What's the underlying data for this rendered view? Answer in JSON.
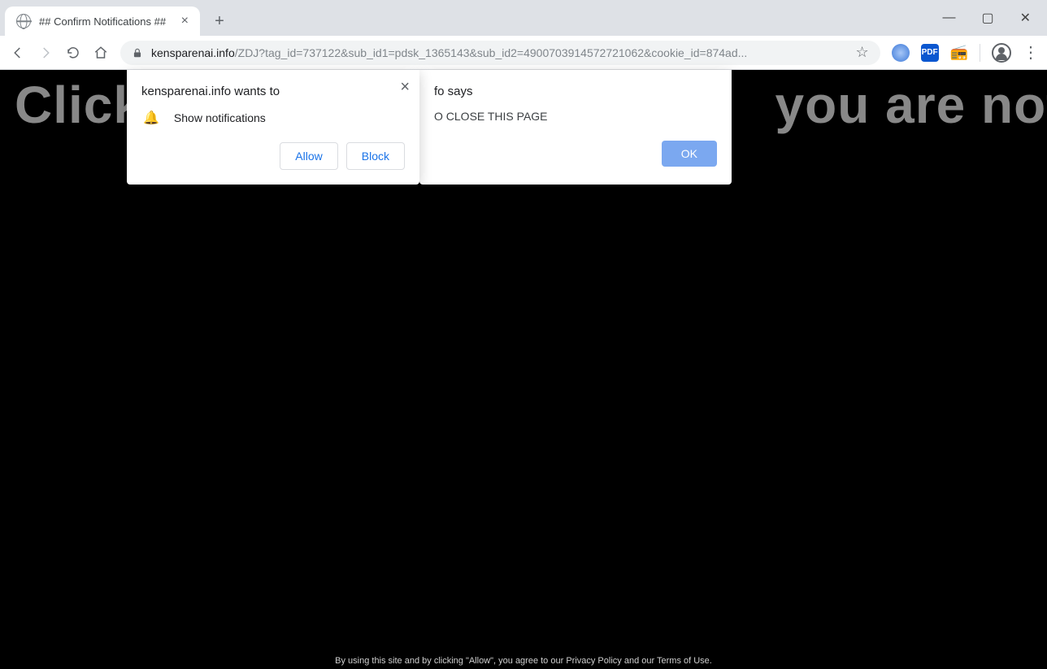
{
  "tab": {
    "title": "## Confirm Notifications ##"
  },
  "url": {
    "host": "kensparenai.info",
    "path": "/ZDJ?tag_id=737122&sub_id1=pdsk_1365143&sub_id2=4900703914572721062&cookie_id=874ad..."
  },
  "extensions": {
    "pdf_label": "PDF"
  },
  "page_content": {
    "headline_left": "Click",
    "headline_right": "you are not a",
    "footer": "By using this site and by clicking \"Allow\", you agree to our Privacy Policy and our Terms of Use."
  },
  "permission_dialog": {
    "origin": "kensparenai.info wants to",
    "request": "Show notifications",
    "allow": "Allow",
    "block": "Block"
  },
  "alert_dialog": {
    "title_suffix": "fo says",
    "message_fragment": "O CLOSE THIS PAGE",
    "ok": "OK"
  }
}
